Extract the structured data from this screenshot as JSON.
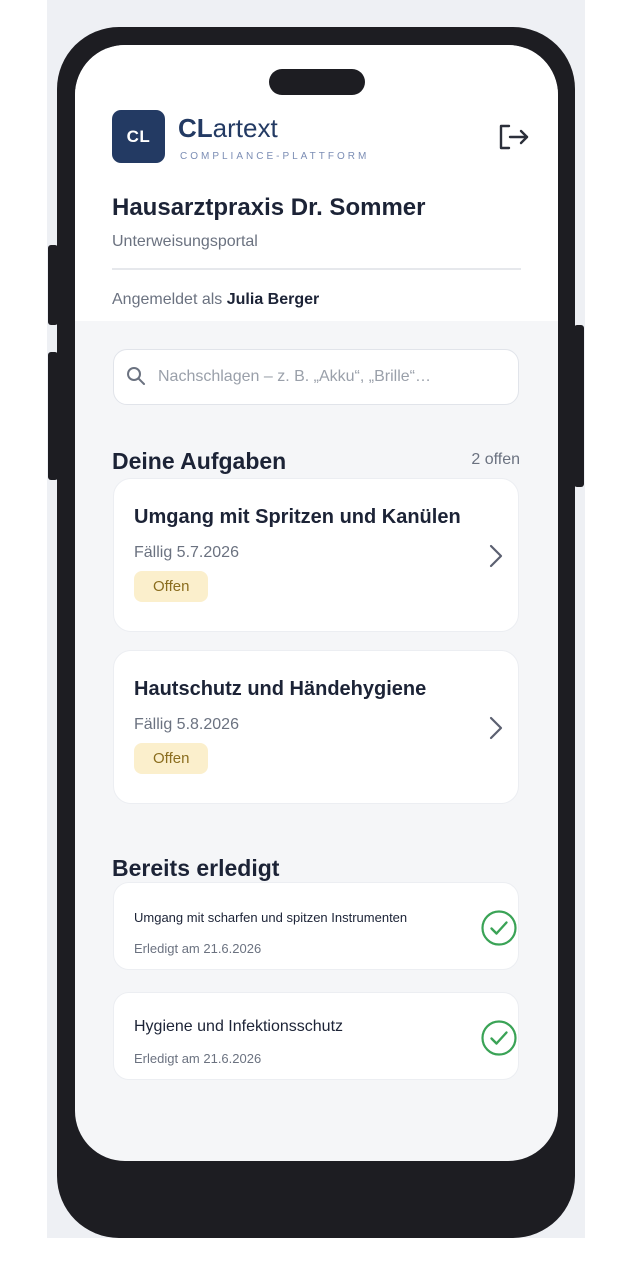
{
  "brand": {
    "logo_initials": "CL",
    "name_bold": "CL",
    "name_rest": "artext",
    "subtitle": "COMPLIANCE-PLATTFORM"
  },
  "practice": {
    "name": "Hausarztpraxis Dr. Sommer",
    "portal": "Unterweisungsportal"
  },
  "session": {
    "prefix": "Angemeldet als",
    "user": "Julia Berger"
  },
  "search": {
    "placeholder": "Nachschlagen – z. B. „Akku“, „Brille“…",
    "value": ""
  },
  "tasks": {
    "title": "Deine Aufgaben",
    "count": "2 offen",
    "items": [
      {
        "title": "Umgang mit Spritzen und Kanülen",
        "due": "Fällig 5.7.2026",
        "status": "Offen"
      },
      {
        "title": "Hautschutz und Händehygiene",
        "due": "Fällig 5.8.2026",
        "status": "Offen"
      }
    ]
  },
  "completed": {
    "title": "Bereits erledigt",
    "items": [
      {
        "title": "Umgang mit scharfen und spitzen Instrumenten",
        "date": "Erledigt am 21.6.2026"
      },
      {
        "title": "Hygiene und Infektionsschutz",
        "date": "Erledigt am 21.6.2026"
      }
    ]
  },
  "colors": {
    "brand": "#233a63",
    "badge_bg": "#fbefcc",
    "badge_text": "#8a6d1e",
    "success": "#3aa356"
  },
  "icons": [
    "logout-icon",
    "search-icon",
    "chevron-right-icon",
    "check-circle-icon"
  ]
}
